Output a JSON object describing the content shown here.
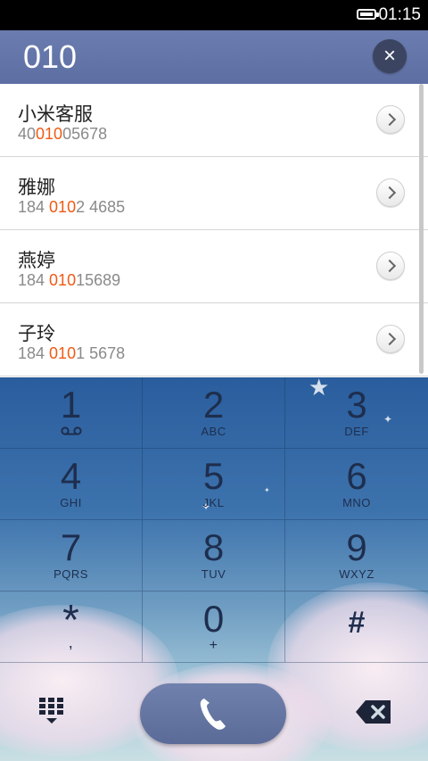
{
  "status_bar": {
    "time": "01:15"
  },
  "search": {
    "query": "010",
    "clear_label": "×"
  },
  "results": [
    {
      "name": "小米客服",
      "number_pre": "40",
      "number_match": "010",
      "number_post": "05678"
    },
    {
      "name": "雅娜",
      "number_pre": "184 ",
      "number_match": "010",
      "number_post": "2 4685"
    },
    {
      "name": "燕婷",
      "number_pre": "184 ",
      "number_match": "010",
      "number_post": "15689"
    },
    {
      "name": "子玲",
      "number_pre": "184 ",
      "number_match": "010",
      "number_post": "1 5678"
    }
  ],
  "keypad": [
    {
      "digit": "1",
      "letters": ""
    },
    {
      "digit": "2",
      "letters": "ABC"
    },
    {
      "digit": "3",
      "letters": "DEF"
    },
    {
      "digit": "4",
      "letters": "GHI"
    },
    {
      "digit": "5",
      "letters": "JKL"
    },
    {
      "digit": "6",
      "letters": "MNO"
    },
    {
      "digit": "7",
      "letters": "PQRS"
    },
    {
      "digit": "8",
      "letters": "TUV"
    },
    {
      "digit": "9",
      "letters": "WXYZ"
    },
    {
      "digit": "*",
      "letters": ","
    },
    {
      "digit": "0",
      "letters": "+"
    },
    {
      "digit": "#",
      "letters": ""
    }
  ],
  "colors": {
    "match_highlight": "#f05a14",
    "header": "#6474a8",
    "call_button": "#6676a3"
  },
  "icons": {
    "voicemail": "voicemail-icon",
    "keypad_toggle": "dialpad-grid-icon",
    "call": "phone-icon",
    "delete": "backspace-icon",
    "detail": "chevron-right-icon"
  }
}
